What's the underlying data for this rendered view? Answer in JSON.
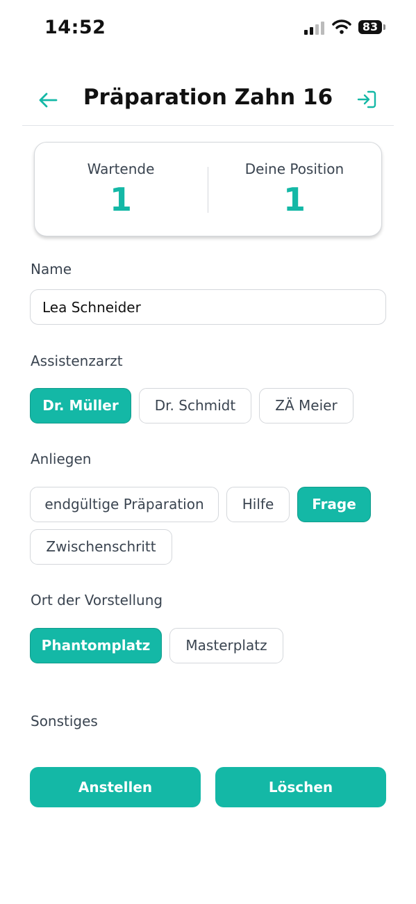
{
  "status_bar": {
    "time": "14:52",
    "battery": "83",
    "icons": [
      "cellular-signal-icon",
      "wifi-icon",
      "battery-icon"
    ]
  },
  "header": {
    "title": "Präparation Zahn 16",
    "back_icon": "arrow-left-icon",
    "exit_icon": "sign-in-icon"
  },
  "queue": {
    "waiting_label": "Wartende",
    "waiting_value": "1",
    "position_label": "Deine Position",
    "position_value": "1"
  },
  "form": {
    "name_label": "Name",
    "name_value": "Lea Schneider",
    "assistant_label": "Assistenzarzt",
    "assistants": [
      {
        "label": "Dr. Müller",
        "selected": true
      },
      {
        "label": "Dr. Schmidt",
        "selected": false
      },
      {
        "label": "ZÄ Meier",
        "selected": false
      }
    ],
    "concern_label": "Anliegen",
    "concerns": [
      {
        "label": "endgültige Präparation",
        "selected": false
      },
      {
        "label": "Hilfe",
        "selected": false
      },
      {
        "label": "Frage",
        "selected": true
      },
      {
        "label": "Zwischenschritt",
        "selected": false
      }
    ],
    "location_label": "Ort der Vorstellung",
    "locations": [
      {
        "label": "Phantomplatz",
        "selected": true
      },
      {
        "label": "Masterplatz",
        "selected": false
      }
    ],
    "other_label": "Sonstiges"
  },
  "actions": {
    "queue_label": "Anstellen",
    "delete_label": "Löschen"
  },
  "colors": {
    "accent": "#14b8a6",
    "border": "#d4d7db",
    "text": "#3a4450"
  }
}
